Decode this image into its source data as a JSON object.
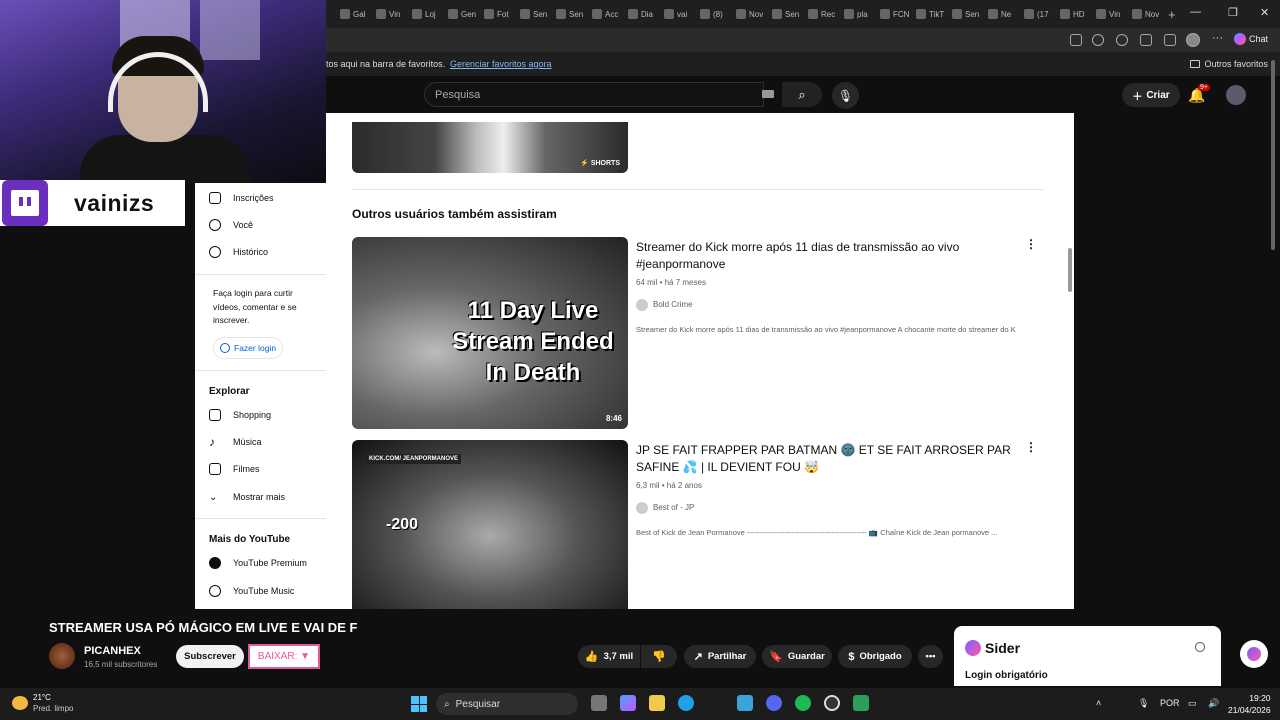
{
  "browser": {
    "tabs": [
      "Gal",
      "Vin",
      "Loj",
      "Gen",
      "Fot",
      "Sen",
      "Sen",
      "Acc",
      "Dia",
      "vai",
      "(8)",
      "Nov",
      "Sen",
      "Rec",
      "pla",
      "FCN",
      "TikT",
      "Sen",
      "Ne",
      "(17",
      "HD",
      "Vin",
      "Nov"
    ],
    "chat_label": "Chat"
  },
  "bookmarks": {
    "text": "tos aqui na barra de favoritos.",
    "manage_link": "Gerenciar favoritos agora",
    "other": "Outros favoritos"
  },
  "header": {
    "search_placeholder": "Pesquisa",
    "create_label": "Criar",
    "notif_badge": "9+"
  },
  "sidebar": {
    "items_top": [
      {
        "label": "Inscrições",
        "icon": "subscriptions-icon"
      },
      {
        "label": "Você",
        "icon": "you-icon"
      },
      {
        "label": "Histórico",
        "icon": "history-icon"
      }
    ],
    "login_text": "Faça login para curtir vídeos, comentar e se inscrever.",
    "login_button": "Fazer login",
    "explore_heading": "Explorar",
    "explore_items": [
      {
        "label": "Shopping",
        "icon": "shopping-icon"
      },
      {
        "label": "Música",
        "icon": "music-icon"
      },
      {
        "label": "Filmes",
        "icon": "movies-icon"
      },
      {
        "label": "Mostrar mais",
        "icon": "chevron-down-icon"
      }
    ],
    "more_heading": "Mais do YouTube",
    "more_items": [
      {
        "label": "YouTube Premium",
        "icon": "youtube-premium-icon"
      },
      {
        "label": "YouTube Music",
        "icon": "youtube-music-icon"
      }
    ]
  },
  "main": {
    "shorts_tag": "SHORTS",
    "section_title": "Outros usuários também assistiram",
    "videos": [
      {
        "title": "Streamer do Kick morre após 11 dias de transmissão ao vivo #jeanpormanove",
        "meta": "64 mil • há 7 meses",
        "channel": "Bold Crime",
        "description": "Streamer do Kick morre após 11 dias de transmissão ao vivo #jeanpormanove A chocante morte do streamer do Kick, Jean ...",
        "duration": "8:46",
        "thumb_text": "11 Day Live Stream Ended In Death"
      },
      {
        "title": "JP SE FAIT FRAPPER PAR BATMAN 🌚 ET SE FAIT ARROSER PAR SAFINE 💦 | IL DEVIENT FOU 🤯",
        "meta": "6,3 mil • há 2 anos",
        "channel": "Best of - JP",
        "description": "Best of Kick de Jean Pormanove ------------------------------------------------ 📺 Chaîne Kick de Jean pormanove ...",
        "thumb_text": "-200",
        "thumb_kick": "KICK.COM/ JEANPORMANOVE"
      }
    ]
  },
  "overlay": {
    "twitch_name": "vainizs"
  },
  "player": {
    "title": "STREAMER USA PÓ MÁGICO EM LIVE E VAI DE F",
    "channel": "PICANHEX",
    "subscribers": "16,5 mil subscritores",
    "subscribe_label": "Subscrever",
    "download_label": "BAIXAR: ▼",
    "likes": "3,7 mil",
    "share_label": "Partilhar",
    "save_label": "Guardar",
    "thanks_label": "Obrigado",
    "more_label": "•••"
  },
  "sider": {
    "name": "Sider",
    "login_text": "Login obrigatório"
  },
  "taskbar": {
    "temperature": "21°C",
    "weather": "Pred. limpo",
    "search_label": "Pesquisar",
    "language": "POR",
    "time": "19:20",
    "date": "21/04/2026"
  }
}
